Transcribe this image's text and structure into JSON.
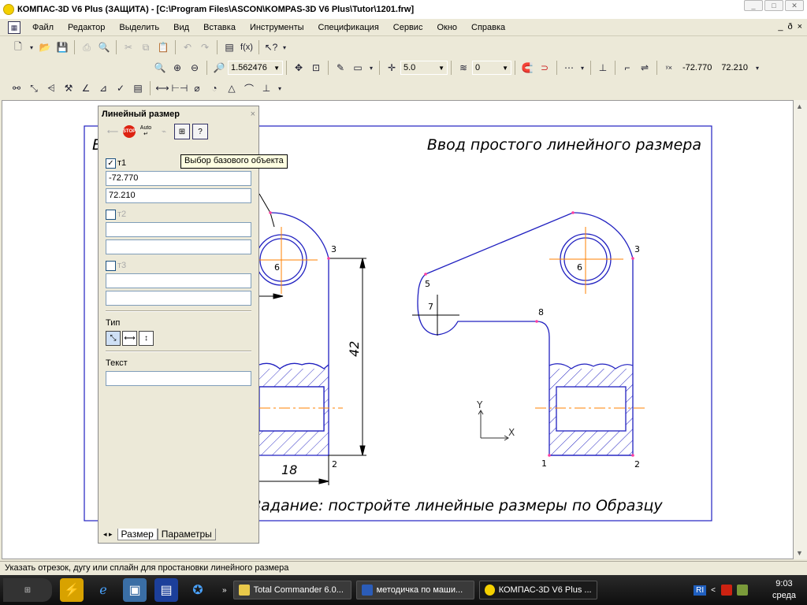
{
  "window": {
    "title": "КОМПАС-3D V6 Plus (ЗАЩИТА) - [C:\\Program Files\\ASCON\\KOMPAS-3D V6 Plus\\Tutor\\1201.frw]",
    "minimize": "_",
    "maximize": "□",
    "close": "✕"
  },
  "menu": {
    "items": [
      "Файл",
      "Редактор",
      "Выделить",
      "Вид",
      "Вставка",
      "Инструменты",
      "Спецификация",
      "Сервис",
      "Окно",
      "Справка"
    ],
    "mdi": [
      "_",
      "ð",
      "×"
    ]
  },
  "toolbar": {
    "zoom_value": "1.562476",
    "step_value": "5.0",
    "layer_value": "0",
    "coord_x": "-72.770",
    "coord_y": "72.210"
  },
  "panel": {
    "title": "Линейный размер",
    "close": "×",
    "stop_label": "STOP",
    "auto_label": "Auto",
    "point1_label": "т1",
    "point1_x": "-72.770",
    "point1_y": "72.210",
    "point2_label": "т2",
    "point2_x": "",
    "point2_y": "",
    "point3_label": "т3",
    "point3_x": "",
    "point3_y": "",
    "type_label": "Тип",
    "text_label": "Текст",
    "text_value": "",
    "tabs": [
      "Размер",
      "Параметры"
    ]
  },
  "tooltip": "Выбор базового объекта",
  "drawing": {
    "title_right": "Ввод простого линейного размера",
    "title_left_fragment": "В",
    "task_text": "Задание: постройте линейные размеры по Образцу",
    "dim_vertical": "42",
    "dim_horizontal": "18",
    "points_left": [
      "3",
      "6",
      "2"
    ],
    "points_right": [
      "1",
      "2",
      "3",
      "5",
      "6",
      "7",
      "8"
    ],
    "axis_y": "Y",
    "axis_x": "X"
  },
  "status": {
    "text": "Указать отрезок, дугу или сплайн для простановки линейного размера"
  },
  "taskbar": {
    "items": [
      {
        "label": "Total Commander 6.0...",
        "color": "#e9c94a"
      },
      {
        "label": "методичка по маши...",
        "color": "#2b5cb8"
      },
      {
        "label": "КОМПАС-3D V6 Plus ...",
        "color": "#f4d000"
      }
    ],
    "lang": "RI",
    "time": "9:03",
    "day": "среда"
  },
  "colors": {
    "drawing_blue": "#2020c0",
    "axis_orange": "#ff8000",
    "point_pink": "#ff40a0"
  }
}
